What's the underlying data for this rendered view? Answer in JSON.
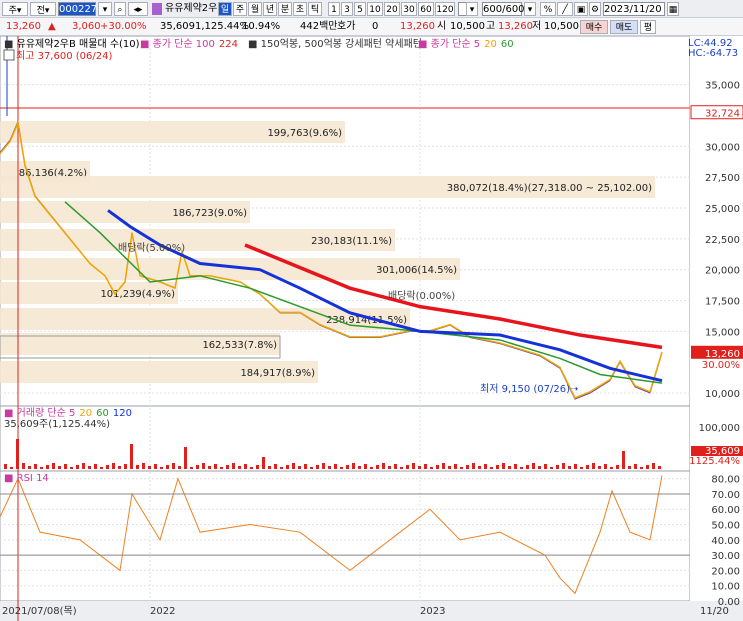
{
  "toolbar": {
    "type_label": "주",
    "prev_label": "전",
    "code": "000227",
    "stock_name": "유유제약2우",
    "period_tabs": [
      "일",
      "주",
      "월",
      "년",
      "분",
      "초",
      "틱"
    ],
    "minute_opts": [
      "1",
      "3",
      "5",
      "10",
      "20",
      "30",
      "60",
      "120"
    ],
    "count": "600/600",
    "date": "2023/11/20"
  },
  "quote": {
    "price": "13,260",
    "change": "3,060",
    "change_pct": "+30.00%",
    "volume": "35,609",
    "vol_ratio": "1,125.44%",
    "turnover": "10.94%",
    "amount": "442백만",
    "hoga_label": "호가",
    "hoga_val": "0",
    "price2": "13,260",
    "open_label": "시",
    "open": "10,500",
    "high_label": "고",
    "high": "13,260",
    "low_label": "저",
    "low": "10,500",
    "buy_label": "매수",
    "sell_label": "매도",
    "eval_label": "평"
  },
  "legend": {
    "main": "유유제약2우B 매물대 수(10)",
    "ma100": "종가 단순 100",
    "ma100_val": "224",
    "pattern": "150억봉, 500억봉 강세패턴 약세패턴",
    "ma_title": "종가 단순 5",
    "ma20": "20",
    "ma60": "60",
    "lc": "LC:44.92",
    "hc": "HC:-64.73",
    "peak": "최고 37,600 (06/24)",
    "low_note": "최저 9,150 (07/26)",
    "vol_title": "거래량 단순 5",
    "vol_20": "20",
    "vol_60": "60",
    "vol_120": "120",
    "vol_now": "35,609주(1,125.44%)",
    "rsi_title": "RSI 14",
    "sup1": "배당락(5.00%)",
    "sup2": "배당락(0.00%)"
  },
  "profile_labels": [
    "199,763(9.6%)",
    "86,136(4.2%)",
    "380,072(18.4%)(27,318.00 ~ 25,102.00)",
    "186,723(9.0%)",
    "230,183(11.1%)",
    "301,006(14.5%)",
    "101,239(4.9%)",
    "238,914(11.5%)",
    "162,533(7.8%)",
    "184,917(8.9%)"
  ],
  "axis": {
    "price_ticks": [
      "35,000",
      "32,724",
      "30,000",
      "27,500",
      "25,000",
      "22,500",
      "20,000",
      "17,500",
      "15,000",
      "13,260",
      "30.00%",
      "10,000"
    ],
    "vol_ticks": [
      "100,000",
      "35,609",
      "1125.44%"
    ],
    "rsi_ticks": [
      "80.00",
      "70.00",
      "60.00",
      "50.00",
      "40.00",
      "30.00",
      "20.00",
      "10.00",
      "0.00"
    ],
    "dates": [
      "2021/07/08(목)",
      "2022",
      "2023",
      "11/20"
    ]
  },
  "colors": {
    "ma5": "#f0a500",
    "ma20": "#2a9a2a",
    "ma60": "#1532d8",
    "ma100": "#e8141c",
    "profile": "#f5e6d0",
    "rsi": "#f08020"
  }
}
